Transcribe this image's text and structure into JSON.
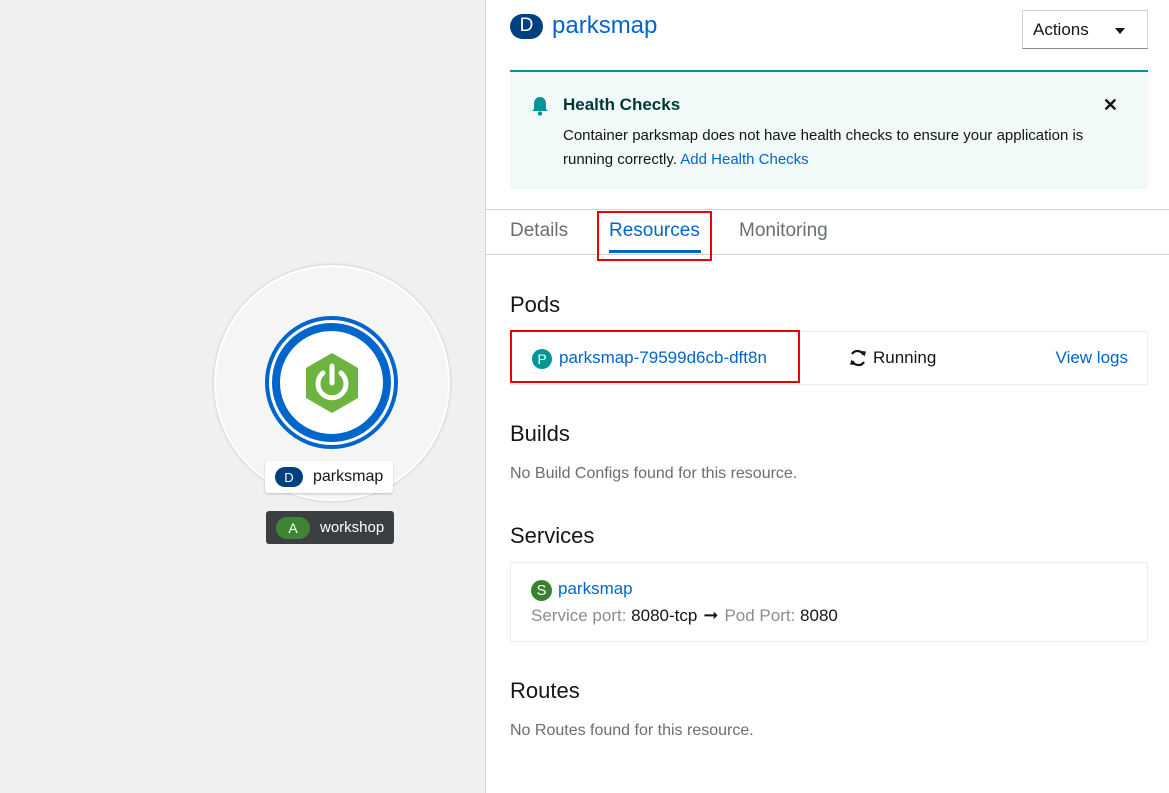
{
  "topology": {
    "node_badge": "D",
    "node_name": "parksmap",
    "app_badge": "A",
    "app_name": "workshop"
  },
  "panel": {
    "resource_badge": "D",
    "resource_name": "parksmap",
    "actions_label": "Actions"
  },
  "alert": {
    "title": "Health Checks",
    "message": "Container parksmap does not have health checks to ensure your application is running correctly.",
    "link": "Add Health Checks"
  },
  "tabs": [
    {
      "label": "Details",
      "active": false
    },
    {
      "label": "Resources",
      "active": true
    },
    {
      "label": "Monitoring",
      "active": false
    }
  ],
  "pods": {
    "heading": "Pods",
    "items": [
      {
        "badge": "P",
        "name": "parksmap-79599d6cb-dft8n",
        "status": "Running",
        "logs_link": "View logs"
      }
    ]
  },
  "builds": {
    "heading": "Builds",
    "empty": "No Build Configs found for this resource."
  },
  "services": {
    "heading": "Services",
    "items": [
      {
        "badge": "S",
        "name": "parksmap",
        "service_port_label": "Service port:",
        "service_port": "8080-tcp",
        "arrow": "➞",
        "pod_port_label": "Pod Port:",
        "pod_port": "8080"
      }
    ]
  },
  "routes": {
    "heading": "Routes",
    "empty": "No Routes found for this resource."
  },
  "colors": {
    "link": "#0066cc",
    "highlight": "#ee0000",
    "alert_bg": "#f2f9f9",
    "alert_accent": "#009596",
    "spring_green": "#6db33f"
  },
  "icons": {
    "spring_logo": "spring-boot-power-icon",
    "alert": "bell-icon",
    "close": "close-icon",
    "status": "sync-icon"
  }
}
